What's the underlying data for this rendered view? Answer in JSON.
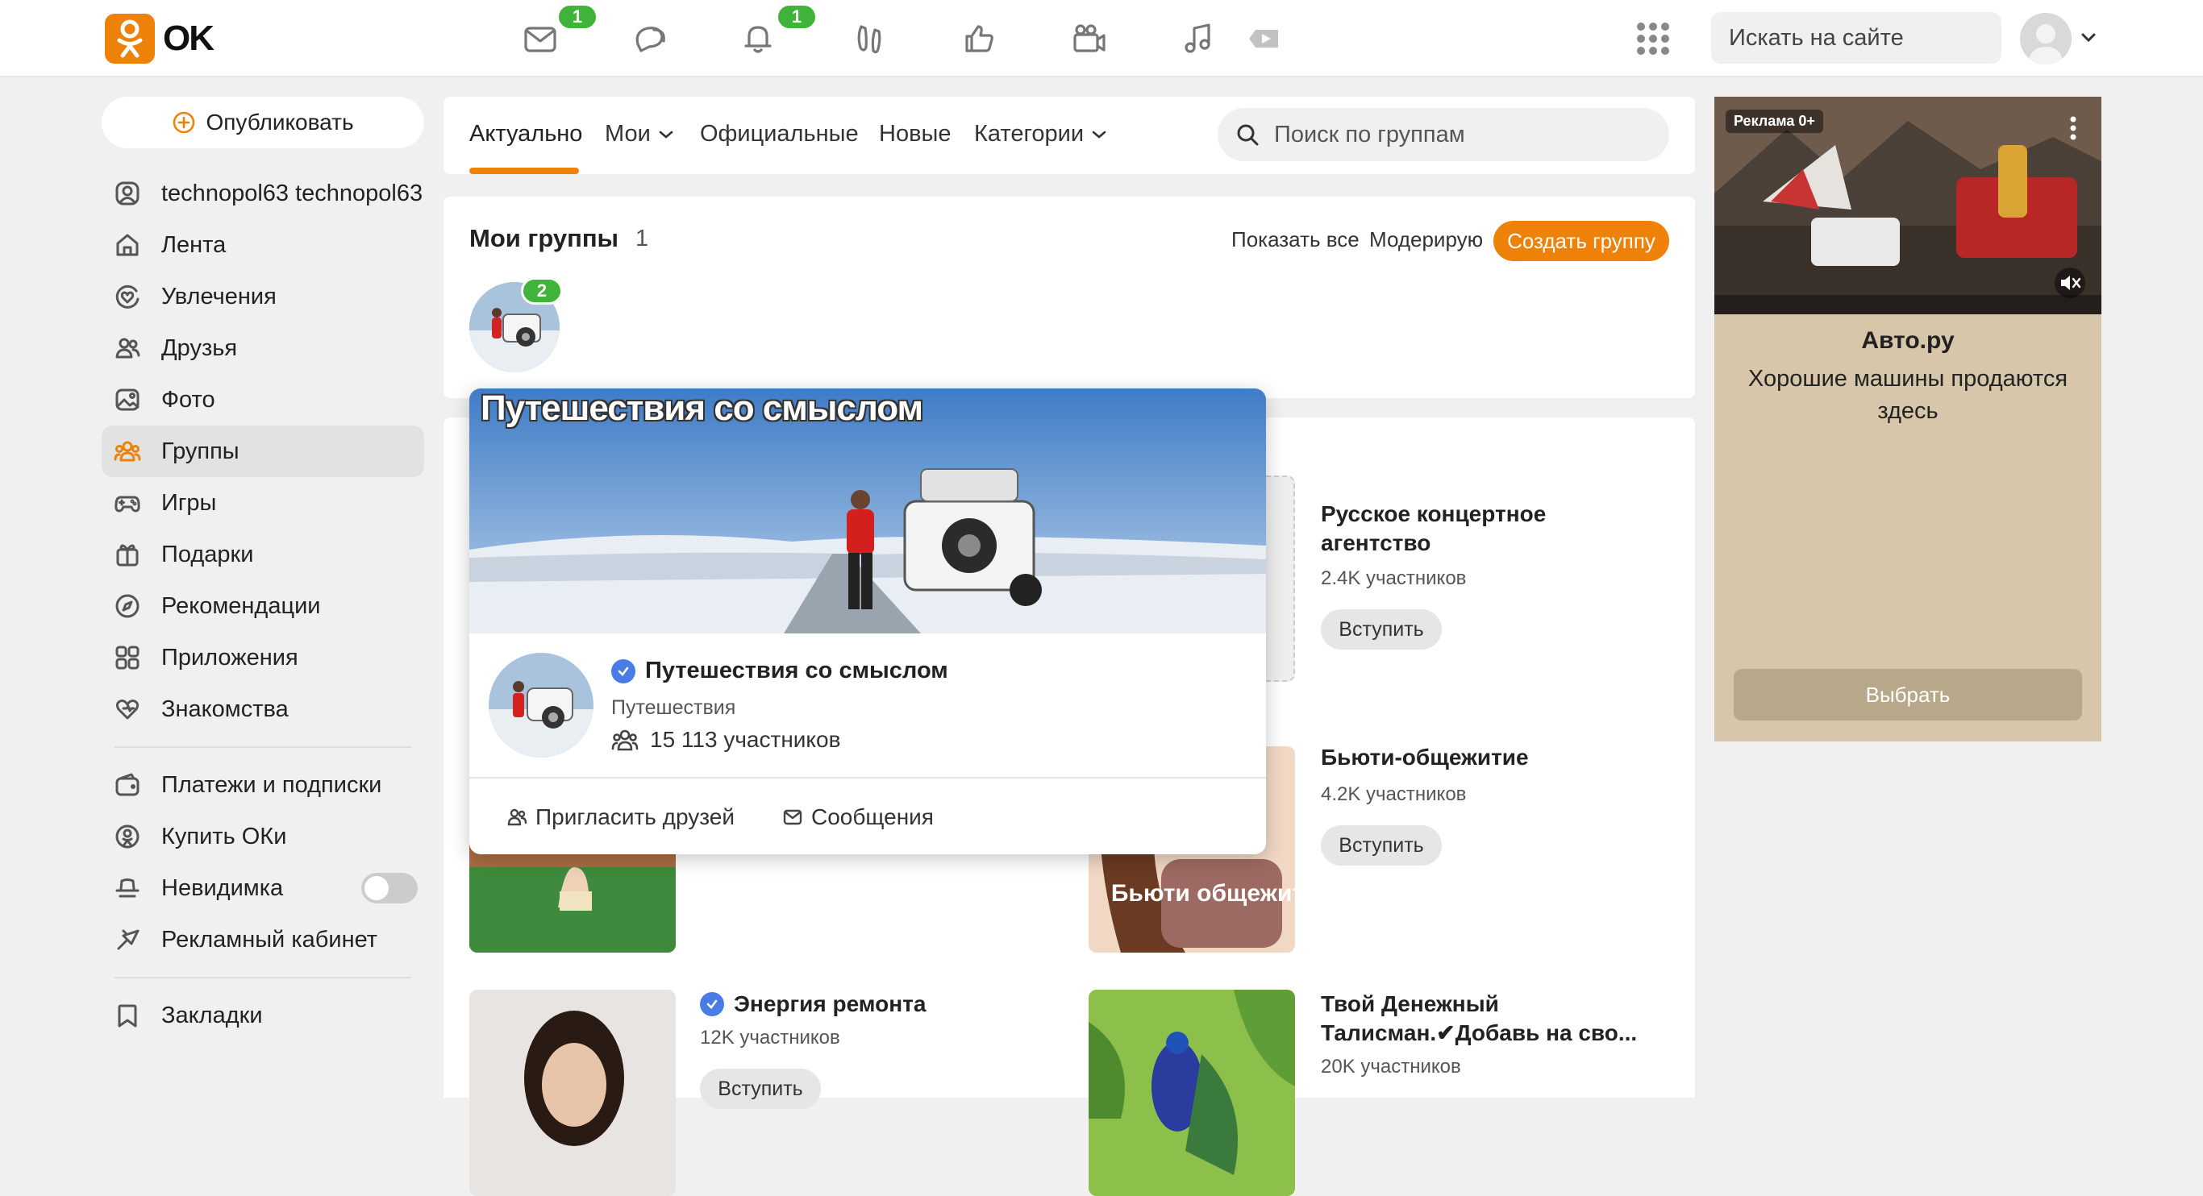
{
  "header": {
    "logo_text": "OK",
    "nav_badges": {
      "messages": "1",
      "notifications": "1"
    },
    "site_search_placeholder": "Искать на сайте"
  },
  "sidebar": {
    "publish_label": "Опубликовать",
    "items": [
      {
        "label": "technopol63 technopol63",
        "icon": "profile-icon"
      },
      {
        "label": "Лента",
        "icon": "home-icon"
      },
      {
        "label": "Увлечения",
        "icon": "heart-circle-icon"
      },
      {
        "label": "Друзья",
        "icon": "friends-icon"
      },
      {
        "label": "Фото",
        "icon": "photo-icon"
      },
      {
        "label": "Группы",
        "icon": "groups-icon",
        "active": true
      },
      {
        "label": "Игры",
        "icon": "gamepad-icon"
      },
      {
        "label": "Подарки",
        "icon": "gift-icon"
      },
      {
        "label": "Рекомендации",
        "icon": "compass-icon"
      },
      {
        "label": "Приложения",
        "icon": "apps-icon"
      },
      {
        "label": "Знакомства",
        "icon": "dating-icon"
      }
    ],
    "items2": [
      {
        "label": "Платежи и подписки",
        "icon": "wallet-icon"
      },
      {
        "label": "Купить ОКи",
        "icon": "ok-coin-icon"
      },
      {
        "label": "Невидимка",
        "icon": "incognito-icon",
        "toggle": false
      },
      {
        "label": "Рекламный кабинет",
        "icon": "ad-cabinet-icon"
      }
    ],
    "items3": [
      {
        "label": "Закладки",
        "icon": "bookmark-icon"
      }
    ]
  },
  "tabs": {
    "items": [
      "Актуально",
      "Мои",
      "Официальные",
      "Новые",
      "Категории"
    ],
    "search_placeholder": "Поиск по группам"
  },
  "my_groups": {
    "title": "Мои группы",
    "count": "1",
    "show_all": "Показать все",
    "moderate": "Модерирую",
    "create": "Создать группу",
    "badge": "2"
  },
  "popup": {
    "cover_title": "Путешествия со смыслом",
    "name": "Путешествия со смыслом",
    "category": "Путешествия",
    "members": "15 113 участников",
    "invite": "Пригласить друзей",
    "messages": "Сообщения"
  },
  "groups": [
    {
      "title": "Русское концертное агентство",
      "members": "2.4K участников",
      "join": "Вступить"
    },
    {
      "title": "Бьюти-общежитие",
      "members": "4.2K участников",
      "join": "Вступить",
      "thumb_text": "Бьюти общежитие"
    },
    {
      "title": "Энергия ремонта",
      "members": "12K участников",
      "join": "Вступить",
      "verified": true
    },
    {
      "title": "Твой Денежный Талисман.✔Добавь на сво...",
      "members": "20K участников"
    }
  ],
  "ad": {
    "label": "Реклама 0+",
    "brand": "Авто.ру",
    "text": "Хорошие машины продаются здесь",
    "button": "Выбрать"
  }
}
